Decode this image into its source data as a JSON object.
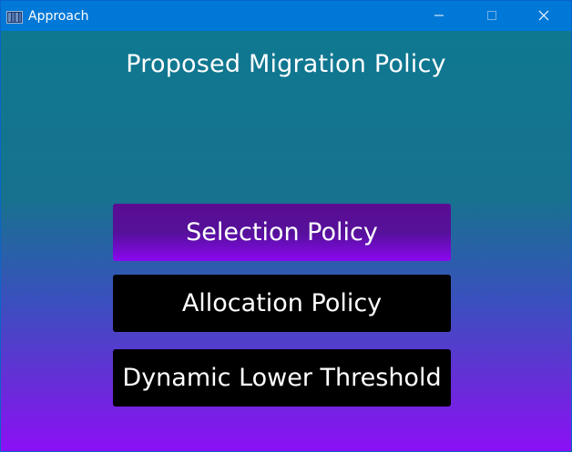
{
  "window": {
    "title": "Approach",
    "icon": "app-window-icon",
    "controls": [
      "minimize-icon",
      "maximize-icon",
      "close-icon"
    ]
  },
  "main": {
    "heading": "Proposed Migration Policy",
    "buttons": [
      {
        "label": "Selection Policy"
      },
      {
        "label": "Allocation Policy"
      },
      {
        "label": "Dynamic Lower Threshold"
      }
    ]
  },
  "colors": {
    "titlebar": "#0078d7",
    "gradient_top": "#0f7891",
    "gradient_bottom": "#8b10f5",
    "selected_button": "#8a08f0",
    "button": "#000000"
  }
}
